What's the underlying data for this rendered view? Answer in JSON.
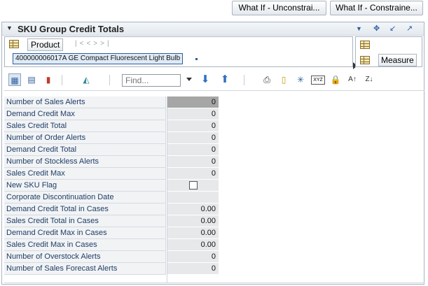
{
  "top_buttons": {
    "whatif_unconstrained": "What If - Unconstrai...",
    "whatif_constrained": "What If - Constraine..."
  },
  "panel": {
    "title": "SKU Group Credit Totals",
    "pov": {
      "product_label": "Product",
      "product_value": "400000006017A GE Compact Fluorescent Light Bulb",
      "measure_label": "Measure"
    },
    "toolbar": {
      "find_placeholder": "Find..."
    },
    "rows": [
      {
        "label": "Number of Sales Alerts",
        "value": "0",
        "selected": true
      },
      {
        "label": "Demand Credit Max",
        "value": "0"
      },
      {
        "label": "Sales Credit Total",
        "value": "0"
      },
      {
        "label": "Number of Order Alerts",
        "value": "0"
      },
      {
        "label": "Demand Credit Total",
        "value": "0"
      },
      {
        "label": "Number of Stockless Alerts",
        "value": "0"
      },
      {
        "label": "Sales Credit Max",
        "value": "0"
      },
      {
        "label": "New SKU Flag",
        "value": "",
        "checkbox": true,
        "checked": false
      },
      {
        "label": "Corporate Discontinuation Date",
        "value": ""
      },
      {
        "label": "Demand Credit Total in Cases",
        "value": "0.00"
      },
      {
        "label": "Sales Credit Total in Cases",
        "value": "0.00"
      },
      {
        "label": "Demand Credit Max in Cases",
        "value": "0.00"
      },
      {
        "label": "Sales Credit Max in Cases",
        "value": "0.00"
      },
      {
        "label": "Number of Overstock Alerts",
        "value": "0"
      },
      {
        "label": "Number of Sales Forecast Alerts",
        "value": "0"
      }
    ]
  }
}
